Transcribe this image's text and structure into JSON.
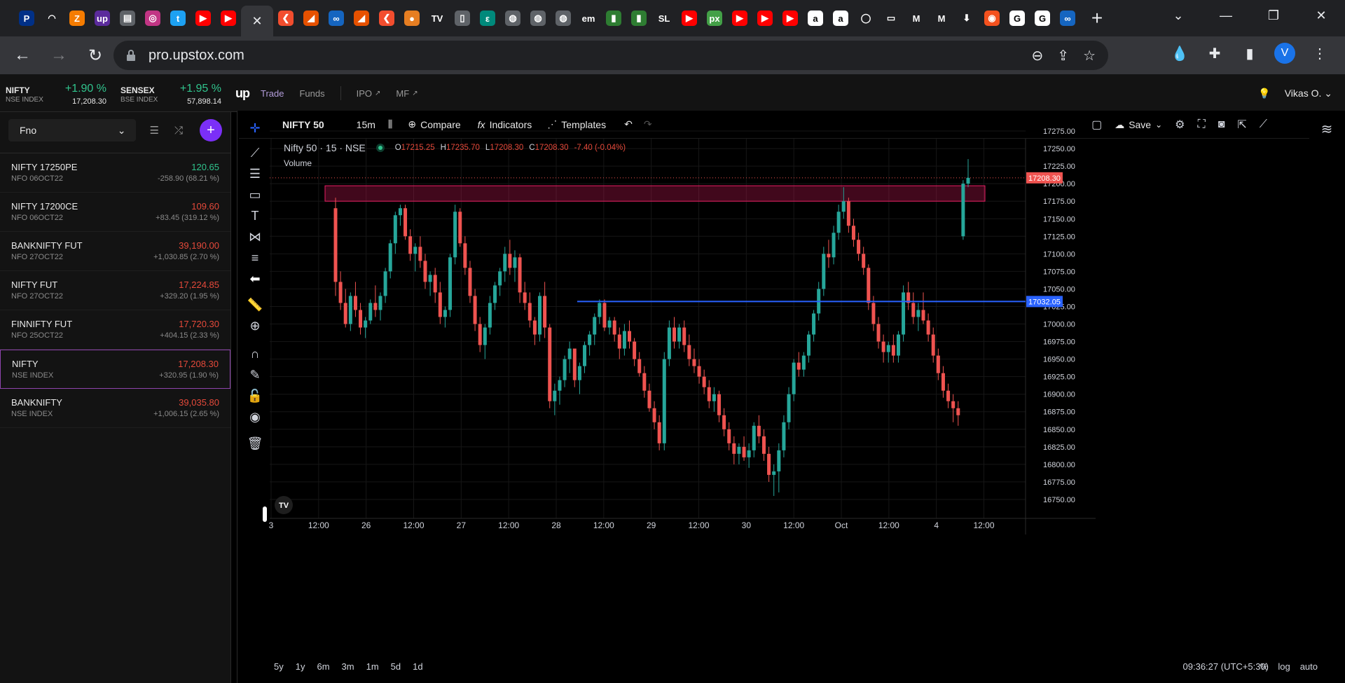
{
  "browser": {
    "url": "pro.upstox.com",
    "tab_icons": [
      {
        "icon": "paypal-icon",
        "color": "#003087",
        "glyph": "P"
      },
      {
        "icon": "airtel-icon",
        "color": "#202124",
        "glyph": "◠"
      },
      {
        "icon": "ext-icon",
        "color": "#f57c00",
        "glyph": "Z"
      },
      {
        "icon": "upstox-icon",
        "color": "#5b2b9c",
        "glyph": "up"
      },
      {
        "icon": "news-icon",
        "color": "#5f6368",
        "glyph": "▤"
      },
      {
        "icon": "instagram-icon",
        "color": "#c13584",
        "glyph": "◎"
      },
      {
        "icon": "twitter-icon",
        "color": "#1da1f2",
        "glyph": "t"
      },
      {
        "icon": "youtube-icon",
        "color": "#ff0000",
        "glyph": "▶"
      },
      {
        "icon": "youtube-icon",
        "color": "#ff0000",
        "glyph": "▶"
      },
      {
        "icon": "zerodha-icon",
        "color": "#f24d2e",
        "glyph": "❮"
      },
      {
        "icon": "sensibull-icon",
        "color": "#e65100",
        "glyph": "◢"
      },
      {
        "icon": "opstra-icon",
        "color": "#1565c0",
        "glyph": "∞"
      },
      {
        "icon": "sensibull-icon",
        "color": "#e65100",
        "glyph": "◢"
      },
      {
        "icon": "zerodha-icon",
        "color": "#f24d2e",
        "glyph": "❮"
      },
      {
        "icon": "ball-icon",
        "color": "#e67e22",
        "glyph": "●"
      },
      {
        "icon": "tradingview-icon",
        "color": "#202124",
        "glyph": "TV"
      },
      {
        "icon": "doc-icon",
        "color": "#5f6368",
        "glyph": "▯"
      },
      {
        "icon": "swirl-icon",
        "color": "#00897b",
        "glyph": "ε"
      },
      {
        "icon": "globe-icon",
        "color": "#5f6368",
        "glyph": "◍"
      },
      {
        "icon": "globe-icon",
        "color": "#5f6368",
        "glyph": "◍"
      },
      {
        "icon": "globe-icon",
        "color": "#5f6368",
        "glyph": "◍"
      },
      {
        "icon": "em-icon",
        "color": "#202124",
        "glyph": "em"
      },
      {
        "icon": "chart-icon",
        "color": "#2e7d32",
        "glyph": "▮"
      },
      {
        "icon": "chart-icon",
        "color": "#2e7d32",
        "glyph": "▮"
      },
      {
        "icon": "sl-icon",
        "color": "#202124",
        "glyph": "SL"
      },
      {
        "icon": "youtube-icon",
        "color": "#ff0000",
        "glyph": "▶"
      },
      {
        "icon": "px-icon",
        "color": "#43a047",
        "glyph": "px"
      },
      {
        "icon": "youtube-icon",
        "color": "#ff0000",
        "glyph": "▶"
      },
      {
        "icon": "youtube-icon",
        "color": "#ff0000",
        "glyph": "▶"
      },
      {
        "icon": "youtube-icon",
        "color": "#ff0000",
        "glyph": "▶"
      },
      {
        "icon": "amazon-icon",
        "color": "#ffffff",
        "glyph": "a"
      },
      {
        "icon": "amazon-icon",
        "color": "#ffffff",
        "glyph": "a"
      },
      {
        "icon": "chat-icon",
        "color": "#202124",
        "glyph": "◯"
      },
      {
        "icon": "record-icon",
        "color": "#202124",
        "glyph": "▭"
      },
      {
        "icon": "gmail-icon",
        "color": "#202124",
        "glyph": "M"
      },
      {
        "icon": "gmail-icon",
        "color": "#202124",
        "glyph": "M"
      },
      {
        "icon": "download-icon",
        "color": "#202124",
        "glyph": "⬇"
      },
      {
        "icon": "chrome-icon",
        "color": "#f4511e",
        "glyph": "◉"
      },
      {
        "icon": "google-icon",
        "color": "#ffffff",
        "glyph": "G"
      },
      {
        "icon": "google-icon",
        "color": "#ffffff",
        "glyph": "G"
      },
      {
        "icon": "opstra-icon",
        "color": "#1565c0",
        "glyph": "∞"
      }
    ]
  },
  "header": {
    "indices": [
      {
        "name": "NIFTY",
        "sub": "NSE INDEX",
        "change": "+1.90 %",
        "value": "17,208.30"
      },
      {
        "name": "SENSEX",
        "sub": "BSE INDEX",
        "change": "+1.95 %",
        "value": "57,898.14"
      }
    ],
    "logo": "up",
    "nav": [
      "Trade",
      "Funds",
      "IPO",
      "MF"
    ],
    "user": "Vikas O."
  },
  "watchlist": {
    "selected": "Fno",
    "items": [
      {
        "name": "NIFTY 17250PE",
        "sub": "NFO 06OCT22",
        "price": "120.65",
        "change": "-258.90 (68.21 %)",
        "dir": "up"
      },
      {
        "name": "NIFTY 17200CE",
        "sub": "NFO 06OCT22",
        "price": "109.60",
        "change": "+83.45 (319.12 %)",
        "dir": "down"
      },
      {
        "name": "BANKNIFTY FUT",
        "sub": "NFO 27OCT22",
        "price": "39,190.00",
        "change": "+1,030.85 (2.70 %)",
        "dir": "down"
      },
      {
        "name": "NIFTY FUT",
        "sub": "NFO 27OCT22",
        "price": "17,224.85",
        "change": "+329.20 (1.95 %)",
        "dir": "down"
      },
      {
        "name": "FINNIFTY FUT",
        "sub": "NFO 25OCT22",
        "price": "17,720.30",
        "change": "+404.15 (2.33 %)",
        "dir": "down"
      },
      {
        "name": "NIFTY",
        "sub": "NSE INDEX",
        "price": "17,208.30",
        "change": "+320.95 (1.90 %)",
        "dir": "down"
      },
      {
        "name": "BANKNIFTY",
        "sub": "NSE INDEX",
        "price": "39,035.80",
        "change": "+1,006.15 (2.65 %)",
        "dir": "down"
      }
    ]
  },
  "chart_toolbar": {
    "symbol": "NIFTY 50",
    "interval": "15m",
    "compare": "Compare",
    "indicators": "Indicators",
    "templates": "Templates",
    "save": "Save"
  },
  "legend": {
    "title": "Nifty 50 · 15 · NSE",
    "o": "17215.25",
    "h": "17235.70",
    "l": "17208.30",
    "c": "17208.30",
    "change": "-7.40 (-0.04%)",
    "volume_label": "Volume"
  },
  "bottom": {
    "ranges": [
      "5y",
      "1y",
      "6m",
      "3m",
      "1m",
      "5d",
      "1d"
    ],
    "clock": "09:36:27 (UTC+5:30)",
    "options": [
      "%",
      "log",
      "auto"
    ]
  },
  "chart_data": {
    "type": "candlestick",
    "y_ticks": [
      "17275.00",
      "17250.00",
      "17225.00",
      "17200.00",
      "17175.00",
      "17150.00",
      "17125.00",
      "17100.00",
      "17075.00",
      "17050.00",
      "17025.00",
      "17000.00",
      "16975.00",
      "16950.00",
      "16925.00",
      "16900.00",
      "16875.00",
      "16850.00",
      "16825.00",
      "16800.00",
      "16775.00",
      "16750.00"
    ],
    "ylim": [
      16735,
      17290
    ],
    "x_ticks": [
      "3",
      "12:00",
      "26",
      "12:00",
      "27",
      "12:00",
      "28",
      "12:00",
      "29",
      "12:00",
      "30",
      "12:00",
      "Oct",
      "12:00",
      "4",
      "12:00"
    ],
    "price_label": "17208.30",
    "hline_label": "17032.05",
    "hline_value": 17032.05,
    "zone": {
      "from": 17175,
      "to": 17197
    },
    "colors": {
      "up": "#26a69a",
      "down": "#ef5350",
      "hline": "#2962ff",
      "zone": "#e91e63"
    },
    "candles": [
      [
        17165,
        17180,
        17040,
        17060
      ],
      [
        17060,
        17075,
        17020,
        17030
      ],
      [
        17030,
        17050,
        16995,
        17000
      ],
      [
        17000,
        17045,
        16990,
        17040
      ],
      [
        17040,
        17060,
        17010,
        17020
      ],
      [
        17020,
        17030,
        16985,
        16995
      ],
      [
        16995,
        17010,
        16980,
        17005
      ],
      [
        17005,
        17035,
        17000,
        17030
      ],
      [
        17030,
        17055,
        17010,
        17020
      ],
      [
        17020,
        17045,
        17005,
        17040
      ],
      [
        17040,
        17080,
        17030,
        17075
      ],
      [
        17075,
        17120,
        17065,
        17115
      ],
      [
        17115,
        17160,
        17100,
        17155
      ],
      [
        17155,
        17170,
        17140,
        17165
      ],
      [
        17165,
        17170,
        17120,
        17125
      ],
      [
        17125,
        17135,
        17090,
        17100
      ],
      [
        17100,
        17115,
        17075,
        17110
      ],
      [
        17110,
        17125,
        17080,
        17090
      ],
      [
        17090,
        17100,
        17050,
        17060
      ],
      [
        17060,
        17075,
        17040,
        17070
      ],
      [
        17070,
        17080,
        17030,
        17045
      ],
      [
        17045,
        17060,
        17000,
        17010
      ],
      [
        17010,
        17025,
        16995,
        17020
      ],
      [
        17020,
        17100,
        17010,
        17095
      ],
      [
        17095,
        17170,
        17085,
        17160
      ],
      [
        17160,
        17165,
        17110,
        17115
      ],
      [
        17115,
        17125,
        17070,
        17080
      ],
      [
        17080,
        17090,
        17030,
        17040
      ],
      [
        17040,
        17050,
        16990,
        17000
      ],
      [
        17000,
        17010,
        16960,
        16970
      ],
      [
        16970,
        17000,
        16950,
        16995
      ],
      [
        16995,
        17040,
        16985,
        17030
      ],
      [
        17030,
        17060,
        17020,
        17055
      ],
      [
        17055,
        17080,
        17040,
        17075
      ],
      [
        17075,
        17110,
        17060,
        17100
      ],
      [
        17100,
        17120,
        17070,
        17080
      ],
      [
        17080,
        17105,
        17060,
        17095
      ],
      [
        17095,
        17100,
        17030,
        17045
      ],
      [
        17045,
        17060,
        17020,
        17030
      ],
      [
        17030,
        17045,
        16995,
        17005
      ],
      [
        17005,
        17010,
        16970,
        16985
      ],
      [
        16985,
        17045,
        16975,
        17040
      ],
      [
        17040,
        17060,
        16980,
        16995
      ],
      [
        16995,
        17000,
        16880,
        16890
      ],
      [
        16890,
        16915,
        16870,
        16905
      ],
      [
        16905,
        16925,
        16885,
        16920
      ],
      [
        16920,
        16955,
        16910,
        16950
      ],
      [
        16950,
        16975,
        16930,
        16965
      ],
      [
        16965,
        16960,
        16910,
        16920
      ],
      [
        16920,
        16945,
        16900,
        16940
      ],
      [
        16940,
        16975,
        16930,
        16970
      ],
      [
        16970,
        16990,
        16955,
        16985
      ],
      [
        16985,
        17015,
        16970,
        17010
      ],
      [
        17010,
        17035,
        17000,
        17030
      ],
      [
        17030,
        17035,
        16990,
        16995
      ],
      [
        16995,
        17010,
        16985,
        17005
      ],
      [
        17005,
        17010,
        16975,
        16985
      ],
      [
        16985,
        16995,
        16950,
        16965
      ],
      [
        16965,
        17000,
        16955,
        16990
      ],
      [
        16990,
        17005,
        16965,
        16975
      ],
      [
        16975,
        16980,
        16940,
        16950
      ],
      [
        16950,
        16960,
        16925,
        16930
      ],
      [
        16930,
        16940,
        16895,
        16905
      ],
      [
        16905,
        16915,
        16875,
        16880
      ],
      [
        16880,
        16890,
        16850,
        16860
      ],
      [
        16860,
        16870,
        16820,
        16830
      ],
      [
        16830,
        16960,
        16820,
        16950
      ],
      [
        16950,
        17005,
        16940,
        16995
      ],
      [
        16995,
        17010,
        16965,
        16975
      ],
      [
        16975,
        17000,
        16965,
        16995
      ],
      [
        16995,
        17005,
        16960,
        16970
      ],
      [
        16970,
        16985,
        16940,
        16950
      ],
      [
        16950,
        16965,
        16930,
        16940
      ],
      [
        16940,
        16950,
        16915,
        16925
      ],
      [
        16925,
        16935,
        16900,
        16910
      ],
      [
        16910,
        16920,
        16880,
        16890
      ],
      [
        16890,
        16910,
        16875,
        16900
      ],
      [
        16900,
        16905,
        16860,
        16870
      ],
      [
        16870,
        16880,
        16840,
        16850
      ],
      [
        16850,
        16860,
        16820,
        16830
      ],
      [
        16830,
        16840,
        16800,
        16815
      ],
      [
        16815,
        16830,
        16800,
        16825
      ],
      [
        16825,
        16840,
        16805,
        16810
      ],
      [
        16810,
        16830,
        16795,
        16820
      ],
      [
        16820,
        16860,
        16810,
        16855
      ],
      [
        16855,
        16870,
        16830,
        16840
      ],
      [
        16840,
        16850,
        16805,
        16815
      ],
      [
        16815,
        16825,
        16775,
        16785
      ],
      [
        16785,
        16800,
        16755,
        16790
      ],
      [
        16790,
        16830,
        16760,
        16820
      ],
      [
        16820,
        16870,
        16810,
        16860
      ],
      [
        16860,
        16910,
        16850,
        16900
      ],
      [
        16900,
        16950,
        16890,
        16945
      ],
      [
        16945,
        16960,
        16925,
        16935
      ],
      [
        16935,
        16960,
        16925,
        16955
      ],
      [
        16955,
        16990,
        16945,
        16985
      ],
      [
        16985,
        17020,
        16975,
        17015
      ],
      [
        17015,
        17060,
        17005,
        17050
      ],
      [
        17050,
        17110,
        17040,
        17100
      ],
      [
        17100,
        17120,
        17080,
        17095
      ],
      [
        17095,
        17140,
        17085,
        17130
      ],
      [
        17130,
        17170,
        17120,
        17160
      ],
      [
        17160,
        17195,
        17150,
        17175
      ],
      [
        17175,
        17180,
        17130,
        17140
      ],
      [
        17140,
        17150,
        17110,
        17120
      ],
      [
        17120,
        17130,
        17090,
        17100
      ],
      [
        17100,
        17110,
        17070,
        17080
      ],
      [
        17080,
        17085,
        17020,
        17030
      ],
      [
        17030,
        17040,
        16990,
        17000
      ],
      [
        17000,
        17010,
        16965,
        16975
      ],
      [
        16975,
        16985,
        16945,
        16960
      ],
      [
        16960,
        16975,
        16945,
        16970
      ],
      [
        16970,
        16985,
        16945,
        16955
      ],
      [
        16955,
        16990,
        16945,
        16985
      ],
      [
        16985,
        17055,
        16975,
        17045
      ],
      [
        17045,
        17060,
        17020,
        17030
      ],
      [
        17030,
        17045,
        17000,
        17010
      ],
      [
        17010,
        17030,
        16990,
        17020
      ],
      [
        17020,
        17045,
        17000,
        17005
      ],
      [
        17005,
        17015,
        16975,
        16985
      ],
      [
        16985,
        16995,
        16945,
        16955
      ],
      [
        16955,
        16965,
        16920,
        16930
      ],
      [
        16930,
        16940,
        16895,
        16905
      ],
      [
        16905,
        16915,
        16880,
        16890
      ],
      [
        16890,
        16900,
        16860,
        16880
      ],
      [
        16880,
        16890,
        16855,
        16870
      ],
      [
        17125,
        17205,
        17120,
        17200
      ],
      [
        17200,
        17235,
        17195,
        17208.3
      ]
    ]
  }
}
